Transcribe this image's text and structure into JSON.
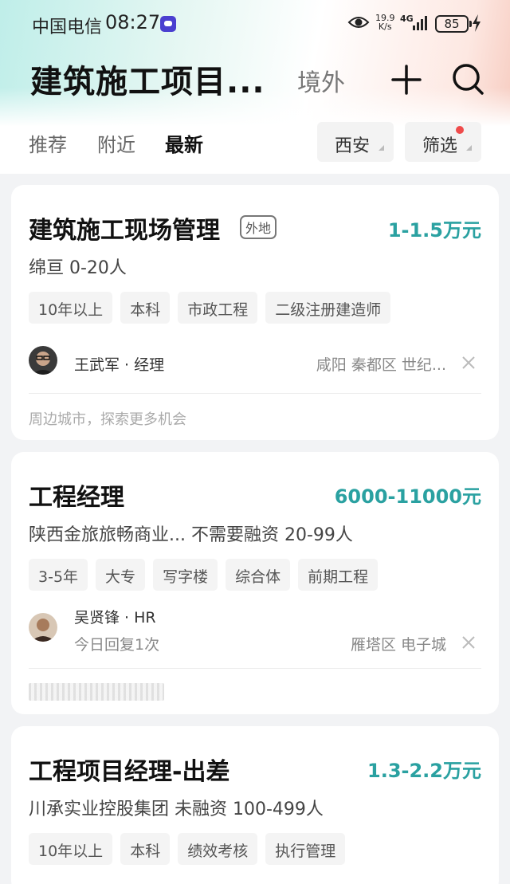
{
  "status_bar": {
    "carrier": "中国电信",
    "time": "08:27",
    "speed_top": "19.9",
    "speed_unit": "K/s",
    "network": "4G",
    "battery": "85"
  },
  "header": {
    "title": "建筑施工项目...",
    "overseas": "境外"
  },
  "tabs": [
    {
      "label": "推荐"
    },
    {
      "label": "附近"
    },
    {
      "label": "最新",
      "active": true
    }
  ],
  "filters": {
    "city": "西安",
    "filter_label": "筛选",
    "dot_color": "#ef4b4b"
  },
  "accent_color": "#2aa1a1",
  "jobs": [
    {
      "title": "建筑施工现场管理",
      "badge": "外地",
      "salary": "1-1.5万元",
      "company": "绵亘  0-20人",
      "tags": [
        "10年以上",
        "本科",
        "市政工程",
        "二级注册建造师"
      ],
      "recruiter": "王武军 · 经理",
      "location": "咸阳  秦都区  世纪...",
      "hint": "周边城市，探索更多机会"
    },
    {
      "title": "工程经理",
      "salary": "6000-11000元",
      "company": "陕西金旅旅畅商业...  不需要融资  20-99人",
      "tags": [
        "3-5年",
        "大专",
        "写字楼",
        "综合体",
        "前期工程"
      ],
      "recruiter": "吴贤锋 · HR",
      "reply": "今日回复1次",
      "location": "雁塔区  电子城"
    },
    {
      "title": "工程项目经理-出差",
      "salary": "1.3-2.2万元",
      "company": "川承实业控股集团  未融资  100-499人",
      "tags": [
        "10年以上",
        "本科",
        "绩效考核",
        "执行管理"
      ]
    }
  ]
}
